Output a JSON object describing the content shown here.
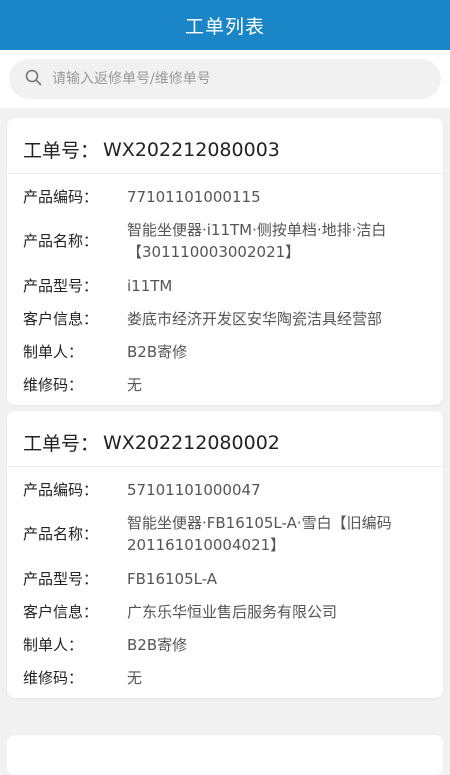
{
  "header": {
    "title": "工单列表"
  },
  "search": {
    "placeholder": "请输入返修单号/维修单号",
    "value": ""
  },
  "labels": {
    "order_no": "工单号：",
    "product_code": "产品编码：",
    "product_name": "产品名称：",
    "product_model": "产品型号：",
    "customer_info": "客户信息：",
    "creator": "制单人：",
    "repair_code": "维修码："
  },
  "orders": [
    {
      "order_no": "WX202212080003",
      "product_code": "77101101000115",
      "product_name": "智能坐便器·i11TM·侧按单档·地排·洁白【301110003002021】",
      "product_model": "i11TM",
      "customer_info": "娄底市经济开发区安华陶瓷洁具经营部",
      "creator": "B2B寄修",
      "repair_code": "无"
    },
    {
      "order_no": "WX202212080002",
      "product_code": "57101101000047",
      "product_name": "智能坐便器·FB16105L-A·雪白【旧编码201161010004021】",
      "product_model": "FB16105L-A",
      "customer_info": "广东乐华恒业售后服务有限公司",
      "creator": "B2B寄修",
      "repair_code": "无"
    }
  ]
}
